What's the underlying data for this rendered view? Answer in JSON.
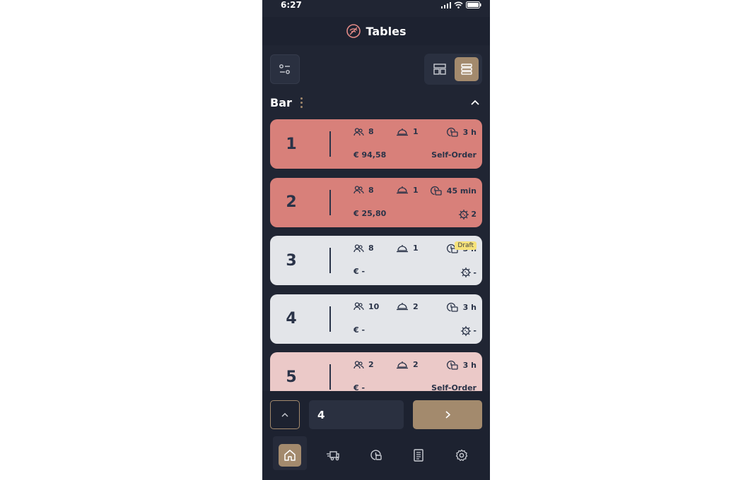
{
  "status": {
    "time": "6:27"
  },
  "header": {
    "title": "Tables",
    "icon": "wifi-off-logo-icon"
  },
  "section": {
    "title": "Bar"
  },
  "colors": {
    "busy": "#d8807a",
    "light": "#e3e5e9",
    "pink": "#ebc9c8",
    "accent": "#a38a6d"
  },
  "tables": [
    {
      "number": "1",
      "guests": "8",
      "orders": "1",
      "duration": "3 h",
      "amount": "€ 94,58",
      "right_label": "Self-Order",
      "badge": "",
      "state": "busy"
    },
    {
      "number": "2",
      "guests": "8",
      "orders": "1",
      "duration": "45 min",
      "amount": "€ 25,80",
      "right_label": "2",
      "badge": "",
      "state": "busy"
    },
    {
      "number": "3",
      "guests": "8",
      "orders": "1",
      "duration": "3 h",
      "amount": "€ -",
      "right_label": "-",
      "badge": "Draft",
      "state": "light"
    },
    {
      "number": "4",
      "guests": "10",
      "orders": "2",
      "duration": "3 h",
      "amount": "€ -",
      "right_label": "-",
      "badge": "",
      "state": "light"
    },
    {
      "number": "5",
      "guests": "2",
      "orders": "2",
      "duration": "3 h",
      "amount": "€ -",
      "right_label": "Self-Order",
      "badge": "",
      "state": "pink"
    }
  ],
  "input": {
    "value": "4"
  },
  "tabs": [
    "home-icon",
    "delivery-icon",
    "timer-icon",
    "receipt-icon",
    "settings-icon"
  ]
}
